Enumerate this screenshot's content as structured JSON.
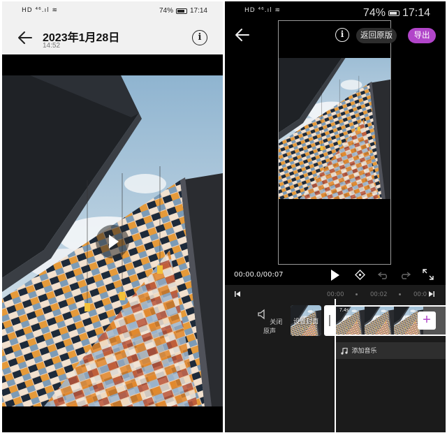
{
  "status_bar": {
    "network": "HD ⁴⁶.ıl ≋",
    "battery": "74%",
    "time": "17:14"
  },
  "viewer": {
    "title": "2023年1月28日",
    "subtitle": "14:52",
    "info_label": "i"
  },
  "editor": {
    "revert_label": "返回原版",
    "export_label": "导出",
    "info_label": "i",
    "time_display": "00:00.0/00:07",
    "ruler_ticks": [
      "00:00",
      "00:02",
      "00:0"
    ],
    "mute_label": "关闭原声",
    "cover_label": "设置封面",
    "clip_duration": "7.4s",
    "add_clip_label": "+",
    "add_music_label": "添加音乐"
  },
  "icons": {
    "back": "arrow-left-icon",
    "info": "info-circle-icon",
    "play": "play-icon",
    "keyframe": "keyframe-diamond-icon",
    "undo": "undo-icon",
    "redo": "redo-icon",
    "fullscreen": "fullscreen-icon",
    "mute": "speaker-icon",
    "music": "music-note-icon"
  },
  "colors": {
    "accent": "#b145c9",
    "editor_bg": "#000000",
    "timeline_bg": "#1b1b1b",
    "viewer_header_bg": "#f1f1f1"
  }
}
